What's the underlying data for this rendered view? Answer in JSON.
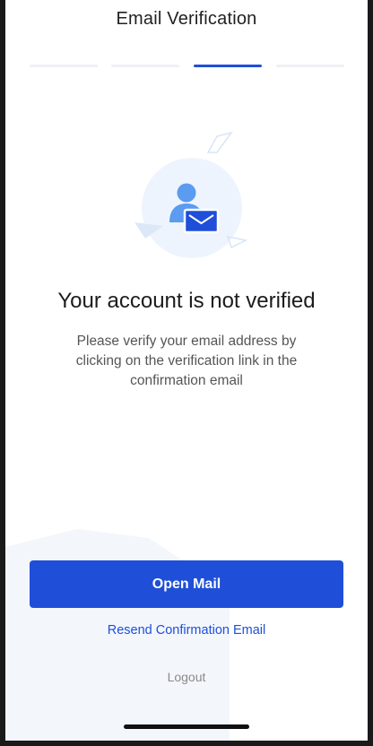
{
  "header": {
    "title": "Email Verification"
  },
  "stepper": {
    "total": 4,
    "current": 3
  },
  "main": {
    "heading": "Your account is not verified",
    "description": "Please verify your email address by clicking on the verification link in the confirmation email"
  },
  "actions": {
    "open_mail_label": "Open Mail",
    "resend_label": "Resend Confirmation Email",
    "logout_label": "Logout"
  },
  "colors": {
    "accent": "#1f4fd8",
    "illustration_bg": "#eef4fd",
    "person": "#5b9bf0"
  },
  "icons": [
    "user-icon",
    "envelope-icon"
  ]
}
